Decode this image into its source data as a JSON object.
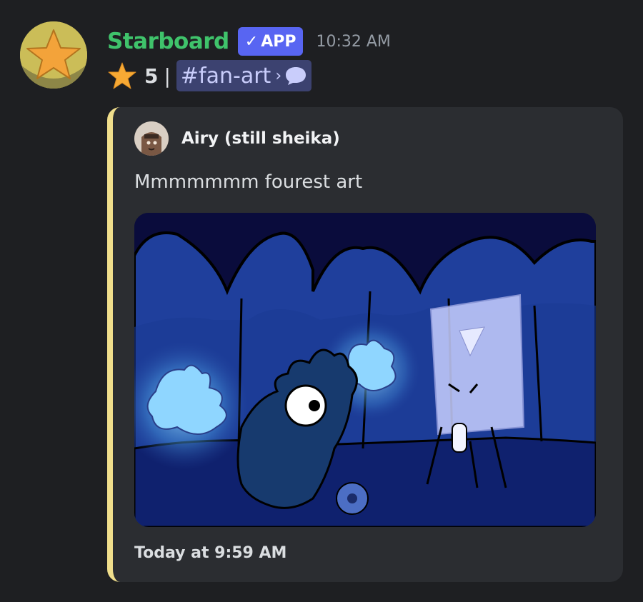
{
  "message": {
    "author": "Starboard",
    "badge": "APP",
    "badge_check": "✓",
    "timestamp": "10:32 AM",
    "star_count": "5",
    "separator": "|",
    "channel": "#fan-art",
    "chevron": "›",
    "colors": {
      "author": "#3fc36b",
      "badge": "#5865f2",
      "embed_accent": "#f0de8c"
    }
  },
  "embed": {
    "author_name": "Airy (still sheika)",
    "description": "Mmmmmmm fourest art",
    "footer": "Today at 9:59 AM",
    "image_icon": "fan-art-image"
  },
  "icons": {
    "avatar": "star-icon",
    "reaction": "star-icon",
    "thread": "speech-bubble-icon"
  }
}
